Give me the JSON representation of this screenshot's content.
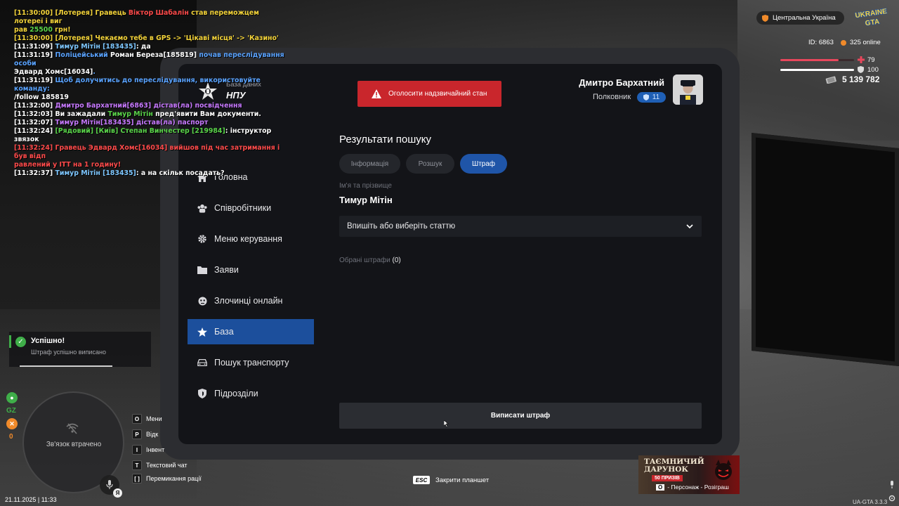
{
  "chat": [
    [
      {
        "t": "[11:30:00] ",
        "c": "y"
      },
      {
        "t": "[Лотерея] ",
        "c": "y"
      },
      {
        "t": "Гравець ",
        "c": "y"
      },
      {
        "t": "Віктор Шабалін ",
        "c": "r"
      },
      {
        "t": "став переможцем лотереї і виг",
        "c": "y"
      }
    ],
    [
      {
        "t": "рав ",
        "c": "y"
      },
      {
        "t": "25500 ",
        "c": "g"
      },
      {
        "t": "грн!",
        "c": "y"
      }
    ],
    [
      {
        "t": "[11:30:00] [Лотерея] Чекаємо тебе в GPS -> 'Цікаві місця' -> 'Казино'",
        "c": "y"
      }
    ],
    [
      {
        "t": "[11:31:09] ",
        "c": "w"
      },
      {
        "t": "Тимур Мітін [183435]",
        "c": "c"
      },
      {
        "t": ": да",
        "c": "w"
      }
    ],
    [
      {
        "t": "[11:31:19] ",
        "c": "w"
      },
      {
        "t": "Поліцейський ",
        "c": "b"
      },
      {
        "t": "Роман Береза[185819] ",
        "c": "w"
      },
      {
        "t": "почав переслідування особи",
        "c": "b"
      }
    ],
    [
      {
        "t": "Эдвард Хомс[16034]",
        "c": "w"
      },
      {
        "t": ".",
        "c": "b"
      }
    ],
    [
      {
        "t": "[11:31:19] ",
        "c": "w"
      },
      {
        "t": "Щоб долучитись до переслідування, використовуйте команду:",
        "c": "b"
      }
    ],
    [
      {
        "t": "/follow 185819",
        "c": "w"
      }
    ],
    [
      {
        "t": "[11:32:00] ",
        "c": "w"
      },
      {
        "t": "Дмитро Бархатний[6863] дістав(ла) посвідчення",
        "c": "p"
      }
    ],
    [
      {
        "t": "[11:32:03] Ви зажадали ",
        "c": "w"
      },
      {
        "t": "Тимур Мітін ",
        "c": "g"
      },
      {
        "t": "пред'явити Вам документи.",
        "c": "w"
      }
    ],
    [
      {
        "t": "[11:32:07] ",
        "c": "w"
      },
      {
        "t": "Тимур Мітін[183435] дістав(ла) паспорт",
        "c": "p"
      }
    ],
    [
      {
        "t": "[11:32:24] ",
        "c": "w"
      },
      {
        "t": "[Рядовий] [Київ]  Степан Винчестер [219984]",
        "c": "g"
      },
      {
        "t": ": інструктор звязок",
        "c": "w"
      }
    ],
    [
      {
        "t": "[11:32:24] Гравець Эдвард Хомс[16034] вийшов під час затримання і був відп",
        "c": "r"
      }
    ],
    [
      {
        "t": "равлений у ІТТ на 1 годину!",
        "c": "r"
      }
    ],
    [
      {
        "t": "[11:32:37] ",
        "c": "w"
      },
      {
        "t": "Тимур Мітін [183435]",
        "c": "c"
      },
      {
        "t": ": а на скільк посадать?",
        "c": "w"
      }
    ]
  ],
  "tablet": {
    "db_subtitle": "База даних",
    "db_title": "НПУ",
    "emergency_label": "Оголосити надзвичайний стан",
    "user_name": "Дмитро Бархатний",
    "user_rank": "Полковник",
    "rank_level": "11"
  },
  "sidebar": [
    {
      "label": "Головна",
      "icon": "home-icon",
      "active": false
    },
    {
      "label": "Співробітники",
      "icon": "users-icon",
      "active": false
    },
    {
      "label": "Меню керування",
      "icon": "gear-icon",
      "active": false
    },
    {
      "label": "Заяви",
      "icon": "folder-icon",
      "active": false
    },
    {
      "label": "Злочинці онлайн",
      "icon": "mask-icon",
      "active": false
    },
    {
      "label": "База",
      "icon": "star-icon",
      "active": true
    },
    {
      "label": "Пошук транспорту",
      "icon": "car-icon",
      "active": false
    },
    {
      "label": "Підрозділи",
      "icon": "shield-icon",
      "active": false
    }
  ],
  "main": {
    "title": "Результати пошуку",
    "tabs": [
      "Інформація",
      "Розшук",
      "Штраф"
    ],
    "active_tab": "Штраф",
    "name_label": "Ім'я та прізвище",
    "person_name": "Тимур Мітін",
    "select_placeholder": "Впишіть або виберіть статтю",
    "selected_label": "Обрані штрафи",
    "selected_count": "(0)",
    "issue_button": "Виписати штраф"
  },
  "hud": {
    "region": "Центральна Україна",
    "logo_text_top": "UKRAINE",
    "logo_text_bottom": "GTA",
    "player_id": "ID: 6863",
    "online": "325 online",
    "health": "79",
    "armor": "100",
    "health_fraction": 0.79,
    "armor_fraction": 1.0,
    "money": "5 139 782",
    "colors": {
      "health": "#e8475c",
      "armor": "#ffffff",
      "accent": "#1f55a8",
      "emergency": "#c9262c"
    }
  },
  "notification": {
    "title": "Успішно!",
    "text": "Штраф успішно виписано",
    "progress_fraction": 0.66
  },
  "minimap": {
    "status": "Зв'язок втрачено",
    "gz_label": "GZ",
    "zero_label": "0"
  },
  "keys": [
    {
      "key": "O",
      "label": "Мени"
    },
    {
      "key": "P",
      "label": "Відк"
    },
    {
      "key": "I",
      "label": "Інвент"
    },
    {
      "key": "T",
      "label": "Текстовий чат"
    },
    {
      "key": "[  ]",
      "label": "Перемикання рації"
    }
  ],
  "mic_badge": "Я",
  "datetime": "21.11.2025 | 11:33",
  "esc": {
    "key": "ESC",
    "label": "Закрити планшет"
  },
  "promo": {
    "title": "ТАЄМНИЧИЙ ДАРУНОК",
    "badge": "50 ПРИЗІВ",
    "key": "O",
    "text": "- Персонаж - Розіграш"
  },
  "version": "UA-GTA 3.3.3"
}
